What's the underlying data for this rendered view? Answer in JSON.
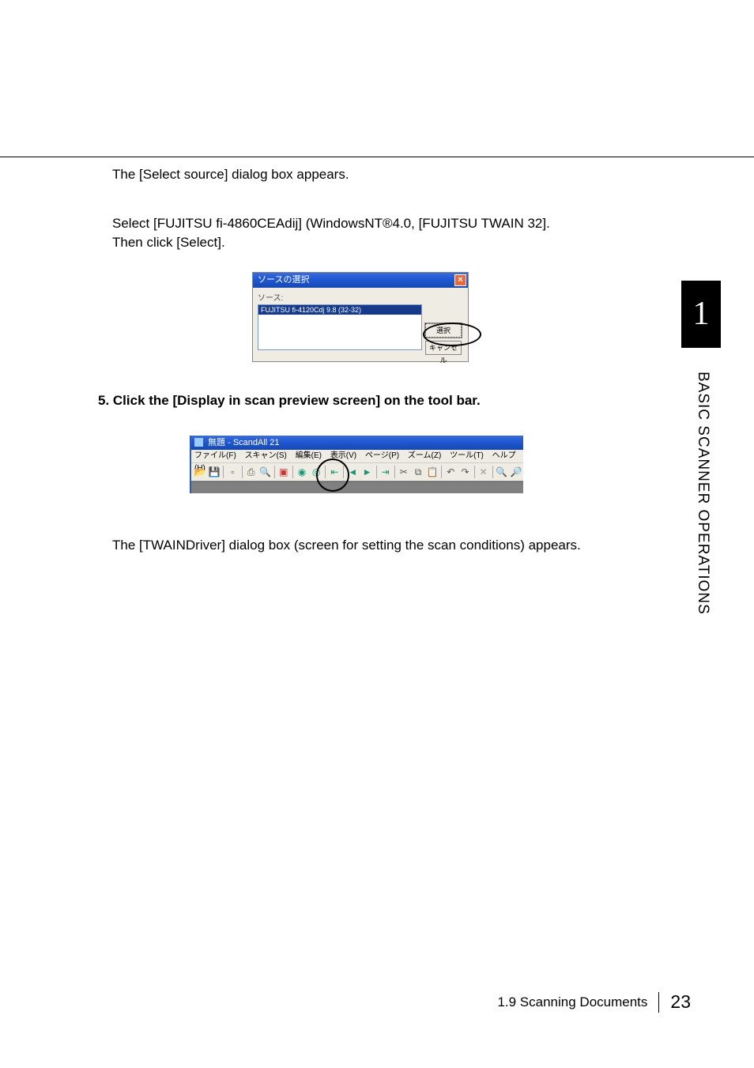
{
  "para1": "The [Select source] dialog box appears.",
  "para2_line1": "Select [FUJITSU fi-4860CEAdij] (WindowsNT®4.0, [FUJITSU TWAIN 32].",
  "para2_line2": "Then click [Select].",
  "step5": "5. Click the [Display in scan preview screen] on the tool bar.",
  "para3": "The [TWAINDriver] dialog box (screen for setting the scan conditions) appears.",
  "tab_number": "1",
  "tab_label": "BASIC SCANNER OPERATIONS",
  "ss": {
    "title": "ソースの選択",
    "close": "×",
    "src_label": "ソース:",
    "list_item": "FUJITSU fi-4120Cdj 9.8 (32-32)",
    "btn_select": "選択",
    "btn_cancel": "キャンセル"
  },
  "sa": {
    "title": "無題 - ScandAll 21",
    "menu": {
      "file": "ファイル(F)",
      "scan": "スキャン(S)",
      "edit": "編集(E)",
      "view": "表示(V)",
      "page": "ページ(P)",
      "zoom": "ズーム(Z)",
      "tool": "ツール(T)",
      "help": "ヘルプ(H)"
    }
  },
  "footer": {
    "section": "1.9  Scanning Documents",
    "page": "23"
  }
}
